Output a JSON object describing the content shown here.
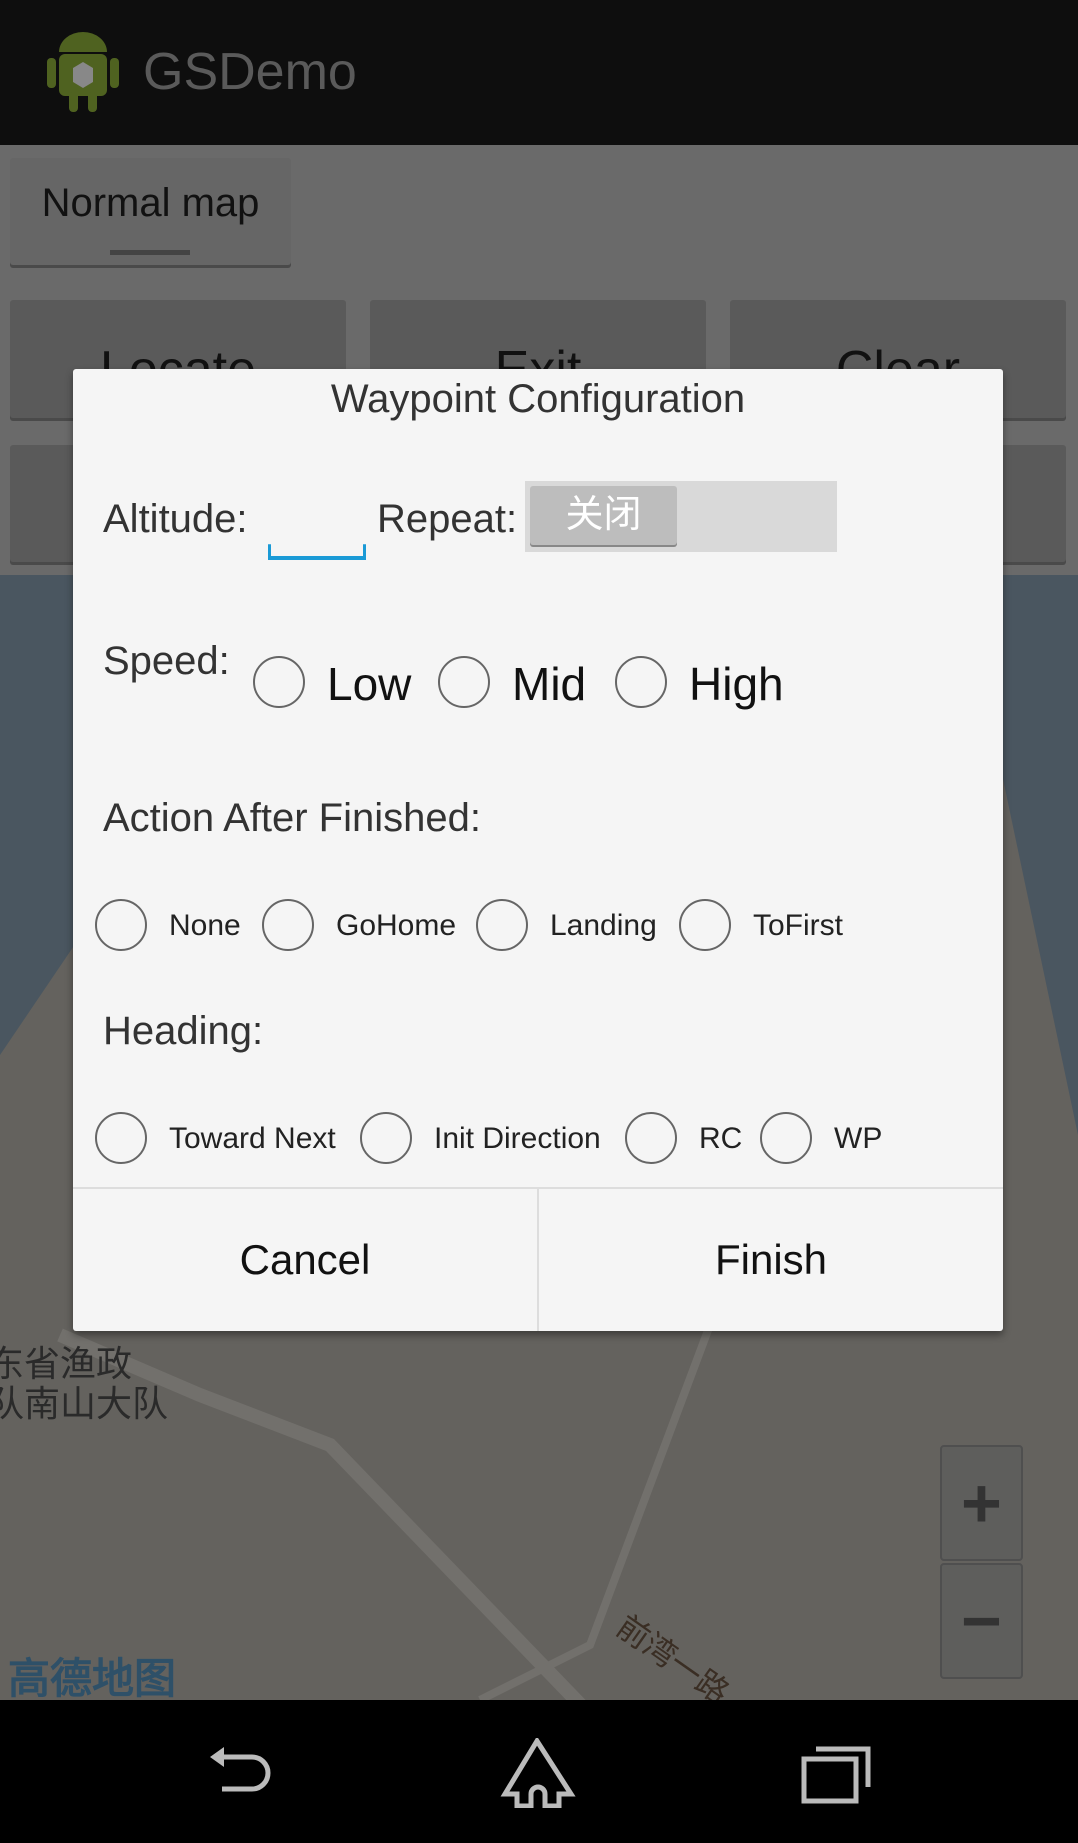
{
  "app": {
    "title": "GSDemo",
    "icon": "android-icon"
  },
  "toolbar": {
    "map_type": "Normal map",
    "buttons": [
      "Locate",
      "Exit",
      "Clear"
    ]
  },
  "map": {
    "labels": [
      "东省渔政",
      "队南山大队"
    ],
    "road_label": "前湾一路",
    "logo": "高德地图",
    "zoom_in": "+",
    "zoom_out": "−"
  },
  "dialog": {
    "title": "Waypoint Configuration",
    "altitude_label": "Altitude:",
    "altitude_value": "",
    "repeat_label": "Repeat:",
    "repeat_switch": "关闭",
    "repeat_on": false,
    "speed_label": "Speed:",
    "speed_options": [
      "Low",
      "Mid",
      "High"
    ],
    "action_label": "Action After Finished:",
    "action_options": [
      "None",
      "GoHome",
      "Landing",
      "ToFirst"
    ],
    "heading_label": "Heading:",
    "heading_options": [
      "Toward Next",
      "Init Direction",
      "RC",
      "WP"
    ],
    "cancel": "Cancel",
    "finish": "Finish"
  },
  "navbar": {
    "back": "back-icon",
    "home": "home-icon",
    "recents": "recents-icon"
  },
  "colors": {
    "accent": "#1a9ad6",
    "dialog_bg": "#f5f5f5"
  }
}
